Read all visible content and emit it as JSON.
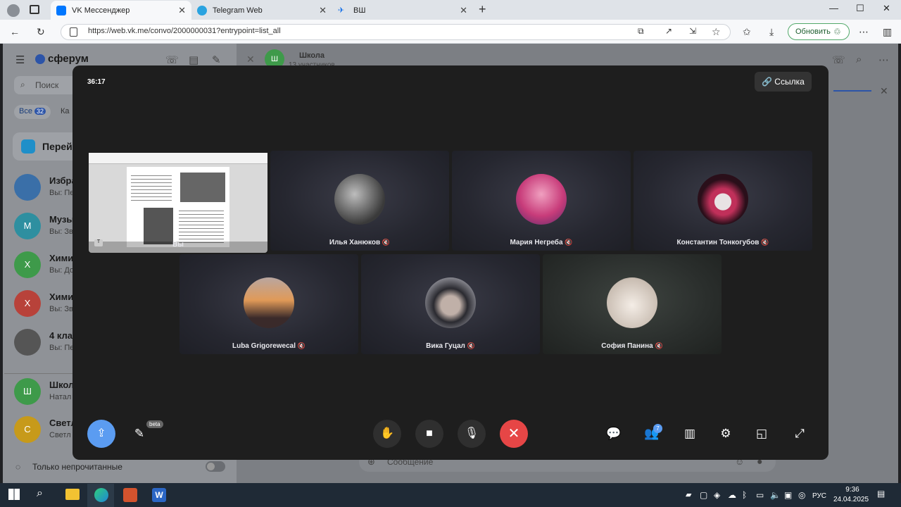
{
  "browser": {
    "tabs": [
      {
        "label": "VK Мессенджер",
        "color": "#0077ff"
      },
      {
        "label": "Telegram Web",
        "color": "#2aa3e0"
      },
      {
        "label": "ВШ",
        "color": "#1a73e8"
      }
    ],
    "url": "https://web.vk.me/convo/2000000031?entrypoint=list_all",
    "update_label": "Обновить"
  },
  "vk": {
    "logo": "сферум",
    "search_placeholder": "Поиск",
    "filter_all": "Все",
    "filter_all_count": "32",
    "filter_next": "Ка",
    "goto_label": "Перейт",
    "chats": [
      {
        "title": "Избра",
        "sub": "Вы: Пе",
        "avatar": "",
        "color": "#3a6fa8"
      },
      {
        "title": "Музы",
        "sub": "Вы: Зв",
        "avatar": "М",
        "color": "#2e8fa0"
      },
      {
        "title": "Хими",
        "sub": "Вы: До",
        "avatar": "Х",
        "color": "#3e9a4a"
      },
      {
        "title": "Хими",
        "sub": "Вы: Зв",
        "avatar": "Х",
        "color": "#b8423a"
      },
      {
        "title": "4 клас",
        "sub": "Вы: Пе",
        "avatar": "",
        "color": "#555"
      },
      {
        "title": "Школ",
        "sub": "Натал",
        "avatar": "Ш",
        "color": "#3e9a4a"
      },
      {
        "title": "Светл",
        "sub": "Светл",
        "avatar": "С",
        "color": "#c79a1a"
      }
    ],
    "unread_only": "Только непрочитанные",
    "chat_title": "Школа",
    "chat_sub": "13 участников",
    "chat_avatar": "Ш",
    "input_placeholder": "Сообщение"
  },
  "call": {
    "timer": "36:17",
    "link_label": "Ссылка",
    "participants": [
      {
        "name": "Вы",
        "you": true
      },
      {
        "name": "Илья Ханюков",
        "avatar_color": "#777"
      },
      {
        "name": "Мария Негреба",
        "avatar_color": "#c83c7a"
      },
      {
        "name": "Константин Тонкогубов",
        "avatar_color": "#5a1e2e"
      },
      {
        "name": "Luba Grigorewecal",
        "avatar_color": "#c9864a"
      },
      {
        "name": "Вика Гуцал",
        "avatar_color": "#4a4550"
      },
      {
        "name": "София Панина",
        "avatar_color": "#d8cfc7"
      }
    ],
    "beta_badge": "beta",
    "participants_count": "7",
    "end_color": "#e64646",
    "share_color": "#5b9cf1"
  },
  "taskbar": {
    "lang": "РУС",
    "time": "9:36",
    "date": "24.04.2025"
  }
}
